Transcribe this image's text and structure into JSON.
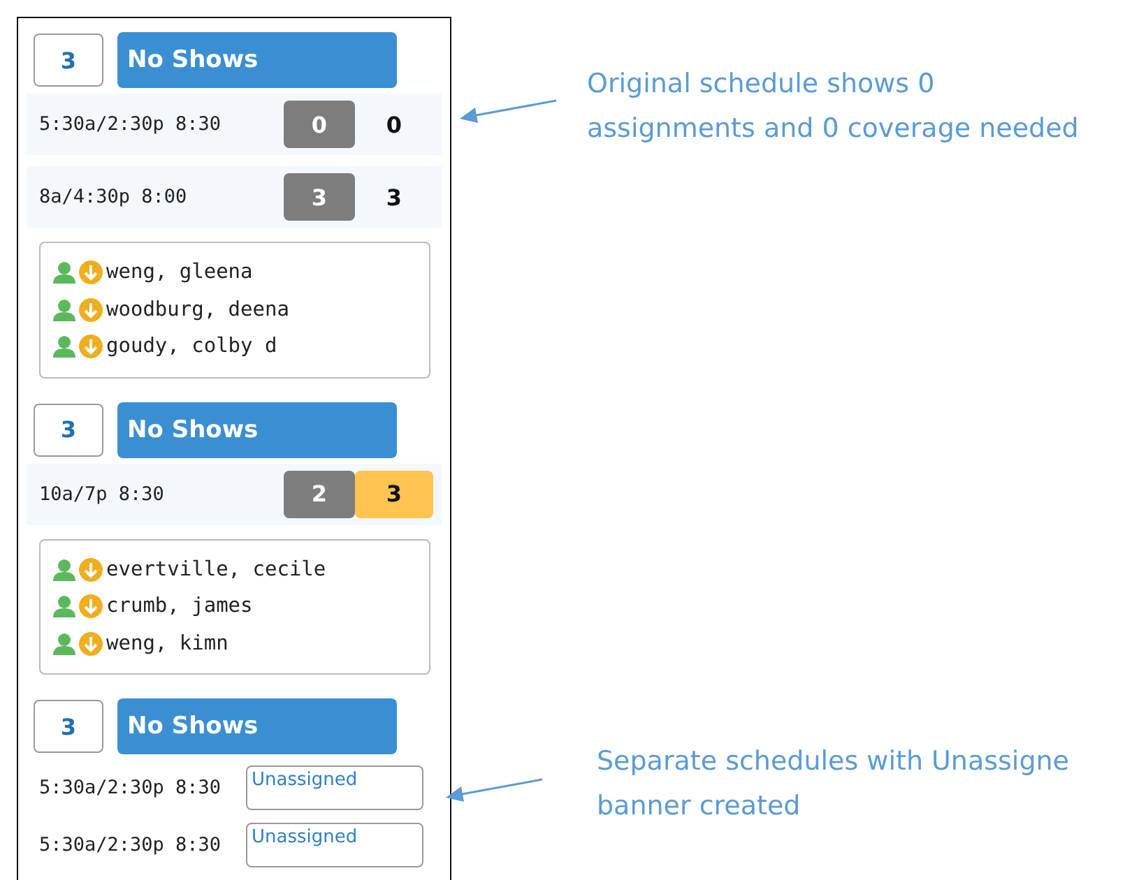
{
  "groups": [
    {
      "count": "3",
      "label": "No Shows",
      "shifts": [
        {
          "kind": "counts",
          "time": "5:30a/2:30p 8:30",
          "assigned": "0",
          "needed": "0",
          "short": false
        },
        {
          "kind": "counts",
          "time": "8a/4:30p 8:00",
          "assigned": "3",
          "needed": "3",
          "short": false
        }
      ],
      "people": [
        "weng, gleena",
        "woodburg, deena",
        "goudy, colby d"
      ]
    },
    {
      "count": "3",
      "label": "No Shows",
      "shifts": [
        {
          "kind": "counts",
          "time": "10a/7p 8:30",
          "assigned": "2",
          "needed": "3",
          "short": true
        }
      ],
      "people": [
        "evertville, cecile",
        "crumb, james",
        "weng, kimn"
      ]
    },
    {
      "count": "3",
      "label": "No Shows",
      "shifts": [
        {
          "kind": "unassigned",
          "time": "5:30a/2:30p 8:30",
          "banner": "Unassigned"
        },
        {
          "kind": "unassigned",
          "time": "5:30a/2:30p 8:30",
          "banner": "Unassigned"
        }
      ]
    }
  ],
  "annotations": [
    {
      "text": "Original schedule shows 0 assignments and 0 coverage needed"
    },
    {
      "text": "Separate schedules with Unassigne banner created"
    }
  ]
}
